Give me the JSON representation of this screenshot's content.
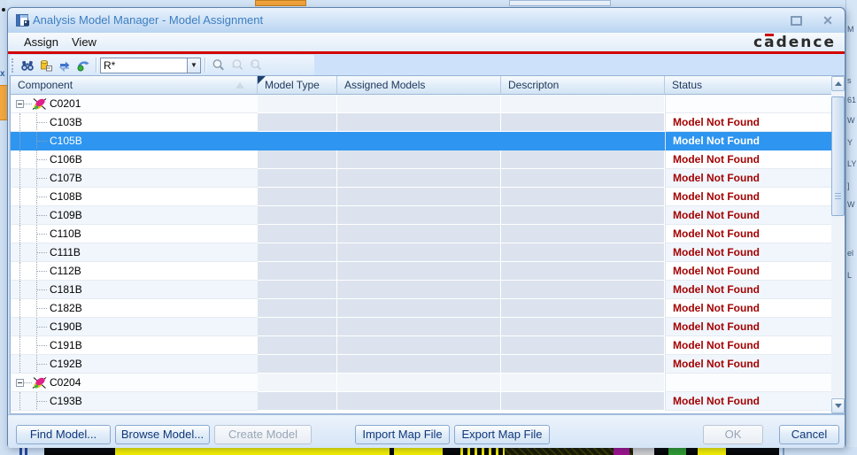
{
  "window": {
    "title": "Analysis Model Manager - Model Assignment",
    "brand": "cadence",
    "close_glyph": "✕"
  },
  "menubar": {
    "items": [
      {
        "label": "Assign"
      },
      {
        "label": "View"
      }
    ]
  },
  "toolbar": {
    "filter": {
      "value": "R*"
    },
    "dropdown_glyph": "▼"
  },
  "grid": {
    "columns": [
      {
        "label": "Component"
      },
      {
        "label": "Model Type"
      },
      {
        "label": "Assigned Models"
      },
      {
        "label": "Descripton"
      },
      {
        "label": "Status"
      }
    ],
    "rows": [
      {
        "component": "C0201",
        "group": true,
        "status": ""
      },
      {
        "component": "C103B",
        "status": "Model Not Found"
      },
      {
        "component": "C105B",
        "status": "Model Not Found",
        "selected": true
      },
      {
        "component": "C106B",
        "status": "Model Not Found"
      },
      {
        "component": "C107B",
        "status": "Model Not Found"
      },
      {
        "component": "C108B",
        "status": "Model Not Found"
      },
      {
        "component": "C109B",
        "status": "Model Not Found"
      },
      {
        "component": "C110B",
        "status": "Model Not Found"
      },
      {
        "component": "C111B",
        "status": "Model Not Found"
      },
      {
        "component": "C112B",
        "status": "Model Not Found"
      },
      {
        "component": "C181B",
        "status": "Model Not Found"
      },
      {
        "component": "C182B",
        "status": "Model Not Found"
      },
      {
        "component": "C190B",
        "status": "Model Not Found"
      },
      {
        "component": "C191B",
        "status": "Model Not Found"
      },
      {
        "component": "C192B",
        "status": "Model Not Found"
      },
      {
        "component": "C0204",
        "group": true,
        "status": ""
      },
      {
        "component": "C193B",
        "status": "Model Not Found"
      }
    ]
  },
  "footer": {
    "buttons": [
      {
        "label": "Find Model...",
        "enabled": true
      },
      {
        "label": "Browse Model...",
        "enabled": true
      },
      {
        "label": "Create Model",
        "enabled": false
      },
      {
        "label": "Import Map File",
        "enabled": true
      },
      {
        "label": "Export Map File",
        "enabled": true
      },
      {
        "label": "OK",
        "enabled": false
      },
      {
        "label": "Cancel",
        "enabled": true
      }
    ]
  },
  "colors": {
    "selection": "#2e95f0",
    "status_error": "#a40202",
    "accent_red": "#d40000"
  },
  "background": {
    "right_fragments": [
      "M",
      "s",
      "61",
      "W",
      "Y",
      "LY",
      "]",
      "W",
      "el",
      "L"
    ]
  }
}
